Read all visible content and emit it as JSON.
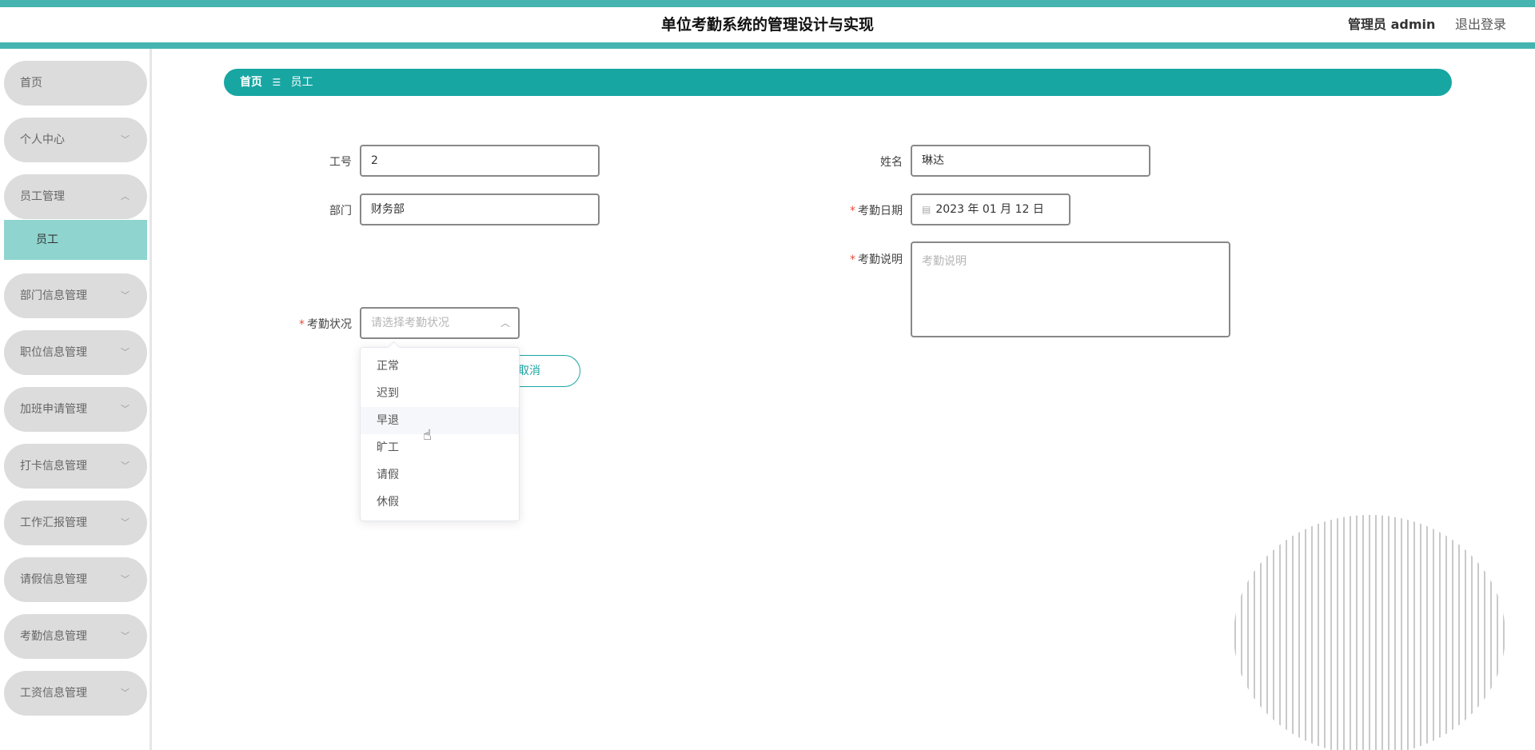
{
  "header": {
    "title": "单位考勤系统的管理设计与实现",
    "admin_label": "管理员 admin",
    "logout": "退出登录"
  },
  "sidebar": {
    "items": [
      {
        "label": "首页",
        "chevron": ""
      },
      {
        "label": "个人中心",
        "chevron": "﹀"
      },
      {
        "label": "员工管理",
        "chevron": "︿"
      },
      {
        "label": "部门信息管理",
        "chevron": "﹀"
      },
      {
        "label": "职位信息管理",
        "chevron": "﹀"
      },
      {
        "label": "加班申请管理",
        "chevron": "﹀"
      },
      {
        "label": "打卡信息管理",
        "chevron": "﹀"
      },
      {
        "label": "工作汇报管理",
        "chevron": "﹀"
      },
      {
        "label": "请假信息管理",
        "chevron": "﹀"
      },
      {
        "label": "考勤信息管理",
        "chevron": "﹀"
      },
      {
        "label": "工资信息管理",
        "chevron": "﹀"
      }
    ],
    "active_sub": "员工"
  },
  "breadcrumb": {
    "home": "首页",
    "separator": "☰",
    "current": "员工"
  },
  "form": {
    "emp_no_label": "工号",
    "emp_no_value": "2",
    "name_label": "姓名",
    "name_value": "琳达",
    "dept_label": "部门",
    "dept_value": "财务部",
    "date_label": "考勤日期",
    "date_value": "2023 年 01 月 12 日",
    "desc_label": "考勤说明",
    "desc_placeholder": "考勤说明",
    "status_label": "考勤状况",
    "status_placeholder": "请选择考勤状况",
    "required_mark": "*",
    "cancel_label": "取消"
  },
  "dropdown": {
    "options": [
      "正常",
      "迟到",
      "早退",
      "旷工",
      "请假",
      "休假"
    ],
    "hovered_index": 2
  }
}
